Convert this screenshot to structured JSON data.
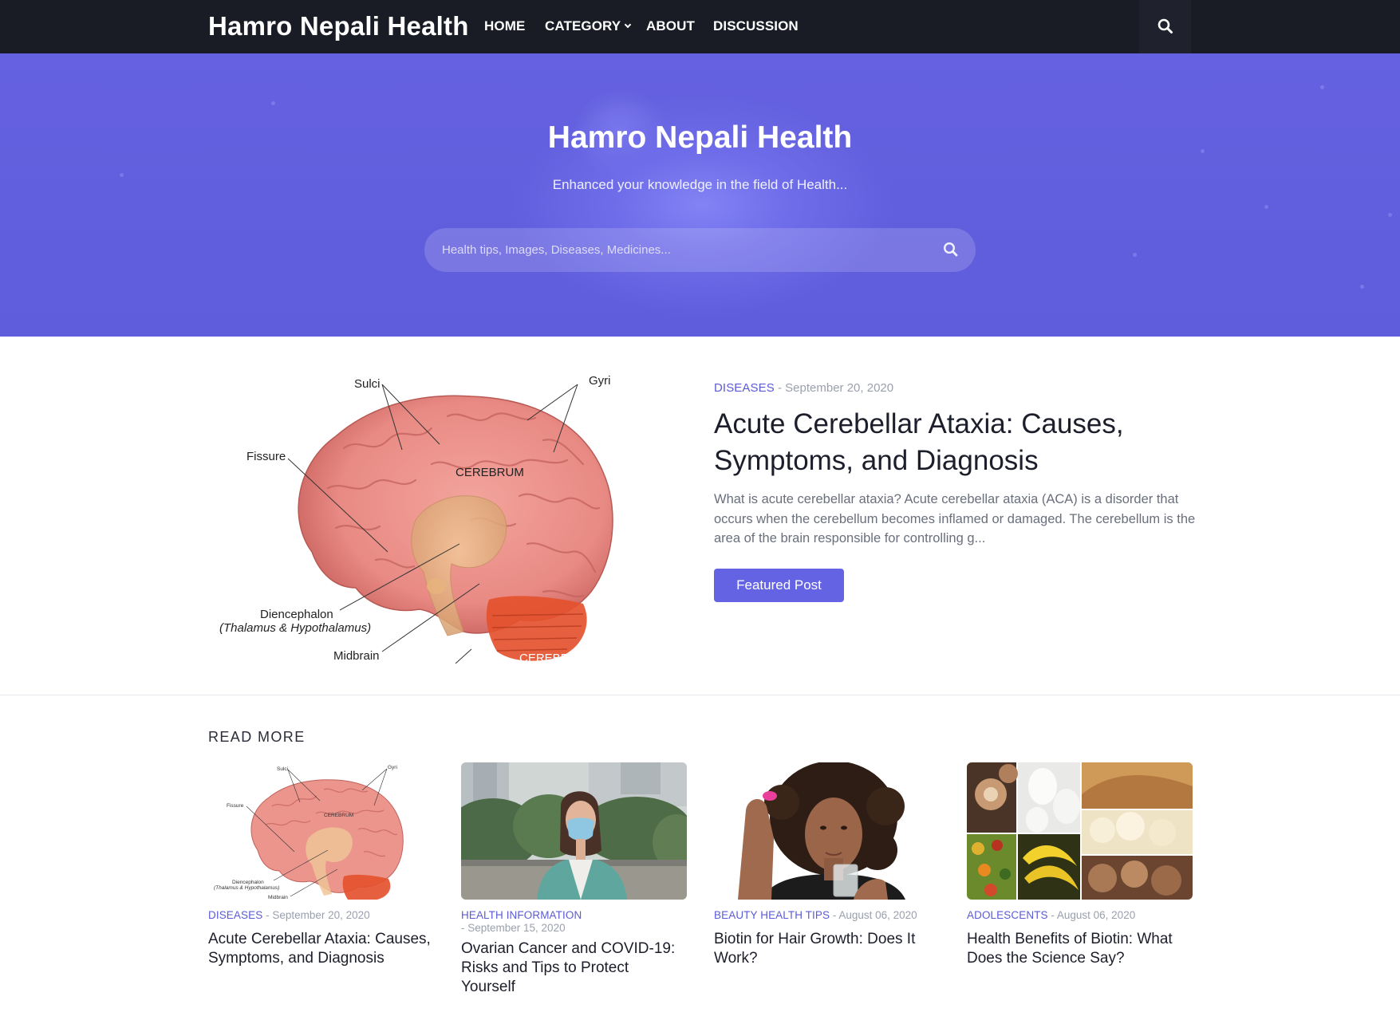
{
  "nav": {
    "brand": "Hamro Nepali Health",
    "items": [
      {
        "label": "HOME"
      },
      {
        "label": "CATEGORY"
      },
      {
        "label": "ABOUT"
      },
      {
        "label": "DISCUSSION"
      }
    ],
    "search_icon": "search-icon"
  },
  "hero": {
    "title": "Hamro Nepali Health",
    "subtitle": "Enhanced your knowledge in the field of Health...",
    "search_placeholder": "Health tips, Images, Diseases, Medicines..."
  },
  "featured": {
    "category": "DISEASES",
    "date": " - September 20, 2020",
    "title": "Acute Cerebellar Ataxia: Causes, Symptoms, and Diagnosis",
    "excerpt": "What is acute cerebellar ataxia? Acute cerebellar ataxia (ACA) is a disorder that occurs when the cerebellum becomes inflamed or damaged. The cerebellum is the area of the brain responsible for controlling g...",
    "button": "Featured Post",
    "image_labels": {
      "sulci": "Sulci",
      "gyri": "Gyri",
      "fissure": "Fissure",
      "cerebrum": "CEREBRUM",
      "diencephalon": "Diencephalon",
      "thalamus": "(Thalamus & Hypothalamus)",
      "midbrain": "Midbrain",
      "cerebellum": "CEREBELLUM"
    }
  },
  "read_more": {
    "heading": "READ MORE",
    "cards": [
      {
        "category": "DISEASES",
        "date": " - September 20, 2020",
        "title": "Acute Cerebellar Ataxia: Causes, Symptoms, and Diagnosis",
        "image": "brain-diagram"
      },
      {
        "category": "HEALTH INFORMATION",
        "date": "- September 15, 2020",
        "title": "Ovarian Cancer and COVID-19: Risks and Tips to Protect Yourself",
        "image": "woman-wearing-mask"
      },
      {
        "category": "BEAUTY HEALTH TIPS",
        "date": " - August 06, 2020",
        "title": "Biotin for Hair Growth: Does It Work?",
        "image": "woman-holding-pill"
      },
      {
        "category": "ADOLESCENTS",
        "date": " - August 06, 2020",
        "title": "Health Benefits of Biotin: What Does the Science Say?",
        "image": "biotin-foods-collage"
      }
    ]
  },
  "colors": {
    "nav_bg": "#191c25",
    "hero_bg": "#6561e0",
    "accent": "#6463e4",
    "category_text": "#5b5bd6",
    "date_text": "#9aa0ad"
  }
}
